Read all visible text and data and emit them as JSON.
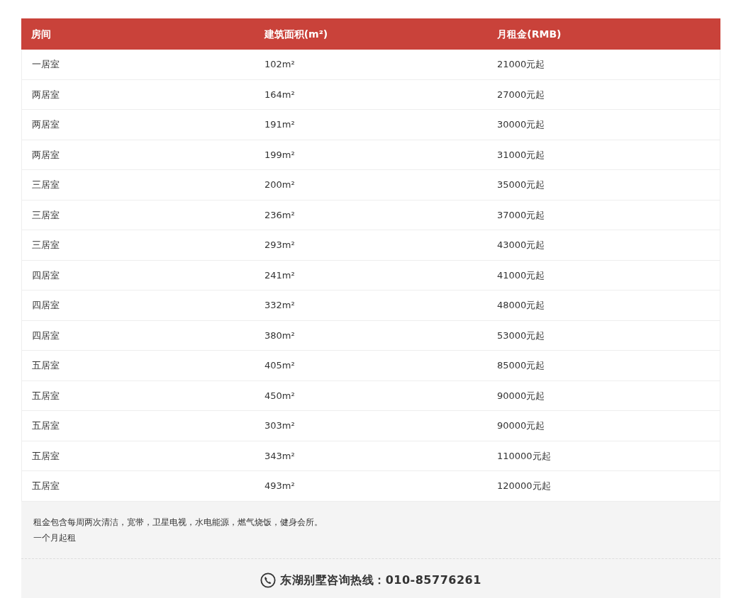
{
  "table": {
    "columns": [
      "房间",
      "建筑面积(m²)",
      "月租金(RMB)"
    ],
    "rows": [
      [
        "一居室",
        "102m²",
        "21000元起"
      ],
      [
        "两居室",
        "164m²",
        "27000元起"
      ],
      [
        "两居室",
        "191m²",
        "30000元起"
      ],
      [
        "两居室",
        "199m²",
        "31000元起"
      ],
      [
        "三居室",
        "200m²",
        "35000元起"
      ],
      [
        "三居室",
        "236m²",
        "37000元起"
      ],
      [
        "三居室",
        "293m²",
        "43000元起"
      ],
      [
        "四居室",
        "241m²",
        "41000元起"
      ],
      [
        "四居室",
        "332m²",
        "48000元起"
      ],
      [
        "四居室",
        "380m²",
        "53000元起"
      ],
      [
        "五居室",
        "405m²",
        "85000元起"
      ],
      [
        "五居室",
        "450m²",
        "90000元起"
      ],
      [
        "五居室",
        "303m²",
        "90000元起"
      ],
      [
        "五居室",
        "343m²",
        "110000元起"
      ],
      [
        "五居室",
        "493m²",
        "120000元起"
      ]
    ]
  },
  "notes": [
    "租金包含每周两次清洁，宽带，卫星电视，水电能源，燃气烧饭，健身会所。",
    "一个月起租"
  ],
  "hotline": "东湖别墅咨询热线：010-85776261"
}
